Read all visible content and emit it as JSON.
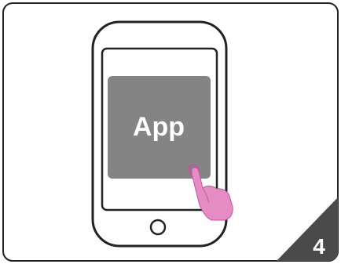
{
  "app_tile": {
    "label": "App"
  },
  "step": {
    "number": "4"
  },
  "icons": {
    "phone": "smartphone-icon",
    "finger": "finger-tap-icon",
    "home_button": "home-button-icon"
  },
  "colors": {
    "outline": "#222222",
    "app_tile": "#848484",
    "corner_badge": "#4a4a4a",
    "finger": "#e58cc4",
    "finger_outline": "#c255a0"
  }
}
